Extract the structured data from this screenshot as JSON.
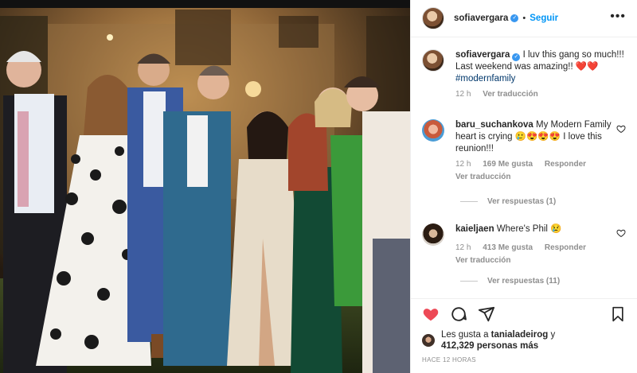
{
  "post": {
    "author": "sofiavergara",
    "follow_label": "Seguir",
    "more_label": "•••",
    "photo_alt": "Modern Family cast group photo"
  },
  "caption": {
    "author": "sofiavergara",
    "text": "I luv this gang so much!!! Last weekend was amazing!! ❤️❤️",
    "hashtag": "#modernfamily",
    "time": "12 h",
    "translate": "Ver traducción"
  },
  "comments": [
    {
      "author": "baru_suchankova",
      "text": "My Modern Family heart is crying 🥲😍😍😍 I love this reunion!!!",
      "time": "12 h",
      "likes": "169 Me gusta",
      "reply": "Responder",
      "translate": "Ver traducción",
      "replies": "Ver respuestas (1)"
    },
    {
      "author": "kaieljaen",
      "text": "Where's Phil 😢",
      "time": "12 h",
      "likes": "413 Me gusta",
      "reply": "Responder",
      "translate": "Ver traducción",
      "replies": "Ver respuestas (11)"
    }
  ],
  "likes_line": {
    "prefix": "Les gusta a",
    "user": "tanialadeirog",
    "suffix": "y",
    "count": "412,329 personas más"
  },
  "posted_ago": "HACE 12 HORAS",
  "colors": {
    "like_red": "#ed4956",
    "link_blue": "#0095f6",
    "verified": "#3897f0",
    "muted": "#8e8e8e"
  },
  "icons": [
    "heart-icon",
    "comment-icon",
    "share-icon",
    "bookmark-icon",
    "verified-icon",
    "more-icon"
  ]
}
